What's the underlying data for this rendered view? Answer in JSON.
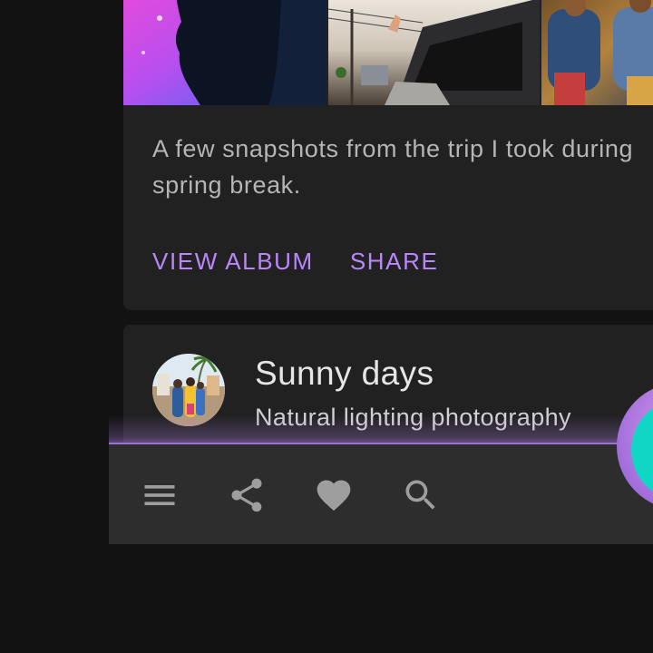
{
  "album_card": {
    "description": "A few snapshots from the trip I took during\nspring break.",
    "actions": {
      "view_album": "VIEW ALBUM",
      "share": "SHARE"
    }
  },
  "post_card": {
    "title": "Sunny days",
    "subtitle": "Natural lighting photography"
  },
  "bottom_bar": {
    "icons": [
      "menu-icon",
      "share-icon",
      "favorite-icon",
      "search-icon"
    ]
  },
  "colors": {
    "background": "#121212",
    "surface": "#212121",
    "bar": "#2d2d2d",
    "primary": "#bb86fc",
    "secondary": "#11d6c5"
  }
}
